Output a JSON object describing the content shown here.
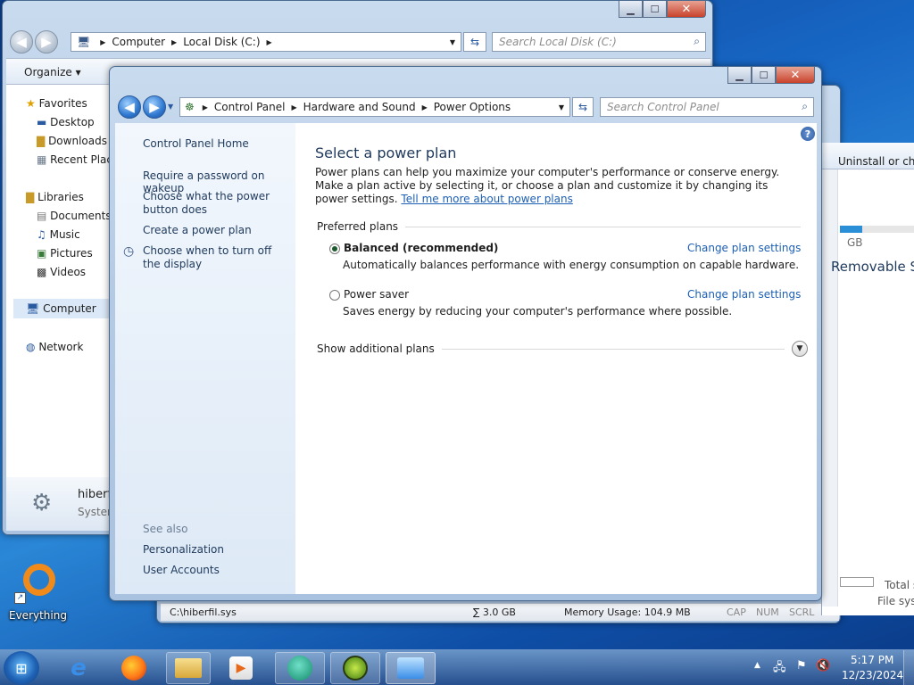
{
  "explorer": {
    "breadcrumb": [
      "Computer",
      "Local Disk (C:)"
    ],
    "search_placeholder": "Search Local Disk (C:)",
    "organize_label": "Organize",
    "nav": {
      "favorites": "Favorites",
      "fav_items": [
        "Desktop",
        "Downloads",
        "Recent Places"
      ],
      "libraries": "Libraries",
      "lib_items": [
        "Documents",
        "Music",
        "Pictures",
        "Videos"
      ],
      "computer": "Computer",
      "network": "Network"
    },
    "details": {
      "name": "hiberfil.sys",
      "type": "System file"
    }
  },
  "explorer2": {
    "toolbar_text": "Uninstall or change a program",
    "gb_text": "GB",
    "storage_text": "Removable Storage (",
    "total_label": "Total s",
    "filesys_label": "File syst"
  },
  "statusbar": {
    "path": "C:\\hiberfil.sys",
    "size": "∑ 3.0 GB",
    "memory": "Memory Usage: 104.9 MB",
    "keys": [
      "CAP",
      "NUM",
      "SCRL"
    ]
  },
  "control_panel": {
    "breadcrumb": [
      "Control Panel",
      "Hardware and Sound",
      "Power Options"
    ],
    "search_placeholder": "Search Control Panel",
    "sidebar": {
      "home": "Control Panel Home",
      "links": [
        "Require a password on wakeup",
        "Choose what the power button does",
        "Create a power plan",
        "Choose when to turn off the display"
      ],
      "see_also": "See also",
      "see_also_links": [
        "Personalization",
        "User Accounts"
      ]
    },
    "main": {
      "title": "Select a power plan",
      "intro": "Power plans can help you maximize your computer's performance or conserve energy. Make a plan active by selecting it, or choose a plan and customize it by changing its power settings.",
      "intro_link": "Tell me more about power plans",
      "preferred_heading": "Preferred plans",
      "plans": [
        {
          "name": "Balanced (recommended)",
          "desc": "Automatically balances performance with energy consumption on capable hardware.",
          "link": "Change plan settings",
          "selected": true
        },
        {
          "name": "Power saver",
          "desc": "Saves energy by reducing your computer's performance where possible.",
          "link": "Change plan settings",
          "selected": false
        }
      ],
      "additional": "Show additional plans"
    }
  },
  "desktop": {
    "everything_label": "Everything"
  },
  "taskbar": {
    "time": "5:17 PM",
    "date": "12/23/2024"
  }
}
